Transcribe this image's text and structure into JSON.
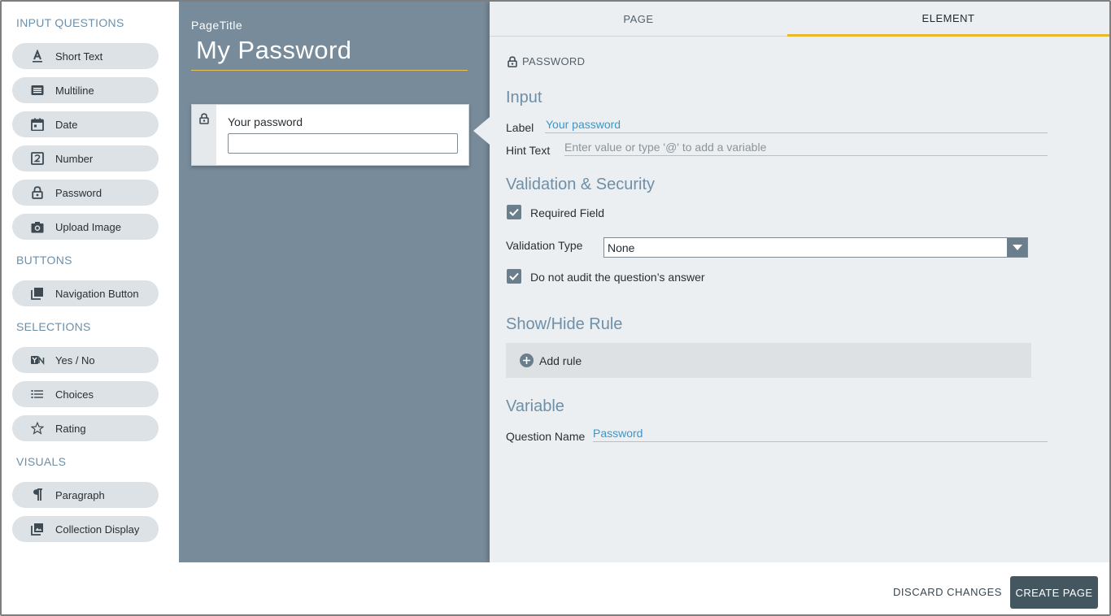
{
  "palette": {
    "groups": {
      "input_questions": "INPUT QUESTIONS",
      "buttons": "BUTTONS",
      "selections": "SELECTIONS",
      "visuals": "VISUALS"
    },
    "items": {
      "short_text": {
        "label": "Short Text",
        "icon": "text-a-icon"
      },
      "multiline": {
        "label": "Multiline",
        "icon": "multiline-icon"
      },
      "date": {
        "label": "Date",
        "icon": "calendar-icon"
      },
      "number": {
        "label": "Number",
        "icon": "number-icon"
      },
      "password": {
        "label": "Password",
        "icon": "lock-icon"
      },
      "upload_image": {
        "label": "Upload Image",
        "icon": "camera-icon"
      },
      "navigation_button": {
        "label": "Navigation Button",
        "icon": "stack-icon"
      },
      "yes_no": {
        "label": "Yes / No",
        "icon": "yes-no-icon"
      },
      "choices": {
        "label": "Choices",
        "icon": "list-icon"
      },
      "rating": {
        "label": "Rating",
        "icon": "star-icon"
      },
      "paragraph": {
        "label": "Paragraph",
        "icon": "pilcrow-icon"
      },
      "collection_display": {
        "label": "Collection Display",
        "icon": "image-stack-icon"
      }
    }
  },
  "canvas": {
    "page_title_label": "PageTitle",
    "page_title_value": "My Password",
    "card": {
      "label": "Your password",
      "value": ""
    }
  },
  "properties": {
    "tabs": {
      "page": "PAGE",
      "element": "ELEMENT"
    },
    "element_type": "PASSWORD",
    "input_section": "Input",
    "label_field": {
      "label": "Label",
      "value": "Your password"
    },
    "hint_field": {
      "label": "Hint Text",
      "placeholder": "Enter value or type '@' to add a variable"
    },
    "validation_section": "Validation & Security",
    "required": {
      "label": "Required Field",
      "checked": true
    },
    "validation_type": {
      "label": "Validation Type",
      "value": "None"
    },
    "no_audit": {
      "label": "Do not audit the question’s answer",
      "checked": true
    },
    "show_hide_section": "Show/Hide Rule",
    "add_rule": "Add rule",
    "variable_section": "Variable",
    "question_name": {
      "label": "Question Name",
      "value": "Password"
    }
  },
  "footer": {
    "discard": "DISCARD CHANGES",
    "create": "CREATE PAGE"
  },
  "colors": {
    "accent_yellow": "#e9b72a",
    "canvas_bg": "#778b9a",
    "link_blue": "#3b96c9",
    "section_blue": "#6e8fa8",
    "primary_button": "#445660"
  }
}
